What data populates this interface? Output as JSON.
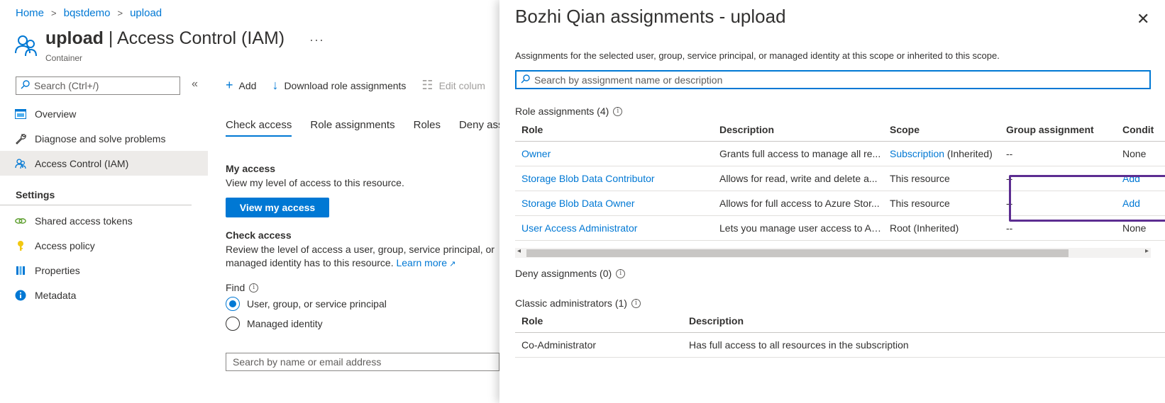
{
  "breadcrumb": [
    "Home",
    "bqstdemo",
    "upload"
  ],
  "header": {
    "title_bold": "upload",
    "title_rest": " | Access Control (IAM)",
    "more": "···",
    "subtitle": "Container"
  },
  "left_search": {
    "placeholder": "Search (Ctrl+/)",
    "collapse": "«"
  },
  "nav": {
    "items": [
      {
        "label": "Overview",
        "icon": "overview-icon"
      },
      {
        "label": "Diagnose and solve problems",
        "icon": "wrench-icon"
      },
      {
        "label": "Access Control (IAM)",
        "icon": "people-icon",
        "active": true
      }
    ],
    "settings_label": "Settings",
    "settings_items": [
      {
        "label": "Shared access tokens",
        "icon": "link-icon"
      },
      {
        "label": "Access policy",
        "icon": "key-icon"
      },
      {
        "label": "Properties",
        "icon": "properties-icon"
      },
      {
        "label": "Metadata",
        "icon": "info-icon"
      }
    ]
  },
  "cmdbar": {
    "add": "Add",
    "download": "Download role assignments",
    "edit_columns": "Edit colum"
  },
  "tabs": [
    "Check access",
    "Role assignments",
    "Roles",
    "Deny ass"
  ],
  "my_access": {
    "heading": "My access",
    "text": "View my level of access to this resource.",
    "button": "View my access"
  },
  "check_access": {
    "heading": "Check access",
    "text1": "Review the level of access a user, group, service principal, or",
    "text2": "managed identity has to this resource.",
    "learn_more": "Learn more",
    "find_label": "Find",
    "option1": "User, group, or service principal",
    "option2": "Managed identity",
    "search_placeholder": "Search by name or email address"
  },
  "panel": {
    "title": "Bozhi Qian assignments - upload",
    "close": "✕",
    "description": "Assignments for the selected user, group, service principal, or managed identity at this scope or inherited to this scope.",
    "search_placeholder": "Search by assignment name or description",
    "role_assignments_label": "Role assignments (4)",
    "role_columns": [
      "Role",
      "Description",
      "Scope",
      "Group assignment",
      "Condit"
    ],
    "role_rows": [
      {
        "role": "Owner",
        "description": "Grants full access to manage all re...",
        "scope_link": "Subscription",
        "scope_rest": " (Inherited)",
        "group": "--",
        "condition": "None",
        "condition_link": false
      },
      {
        "role": "Storage Blob Data Contributor",
        "description": "Allows for read, write and delete a...",
        "scope_link": "",
        "scope_rest": "This resource",
        "group": "--",
        "condition": "Add",
        "condition_link": true
      },
      {
        "role": "Storage Blob Data Owner",
        "description": "Allows for full access to Azure Stor...",
        "scope_link": "",
        "scope_rest": "This resource",
        "group": "--",
        "condition": "Add",
        "condition_link": true
      },
      {
        "role": "User Access Administrator",
        "description": "Lets you manage user access to Az...",
        "scope_link": "",
        "scope_rest": "Root (Inherited)",
        "group": "--",
        "condition": "None",
        "condition_link": false
      }
    ],
    "deny_label": "Deny assignments (0)",
    "classic_label": "Classic administrators (1)",
    "classic_columns": [
      "Role",
      "Description"
    ],
    "classic_rows": [
      {
        "role": "Co-Administrator",
        "description": "Has full access to all resources in the subscription"
      }
    ]
  },
  "colors": {
    "accent": "#0078d4",
    "highlight": "#5c2d91"
  }
}
